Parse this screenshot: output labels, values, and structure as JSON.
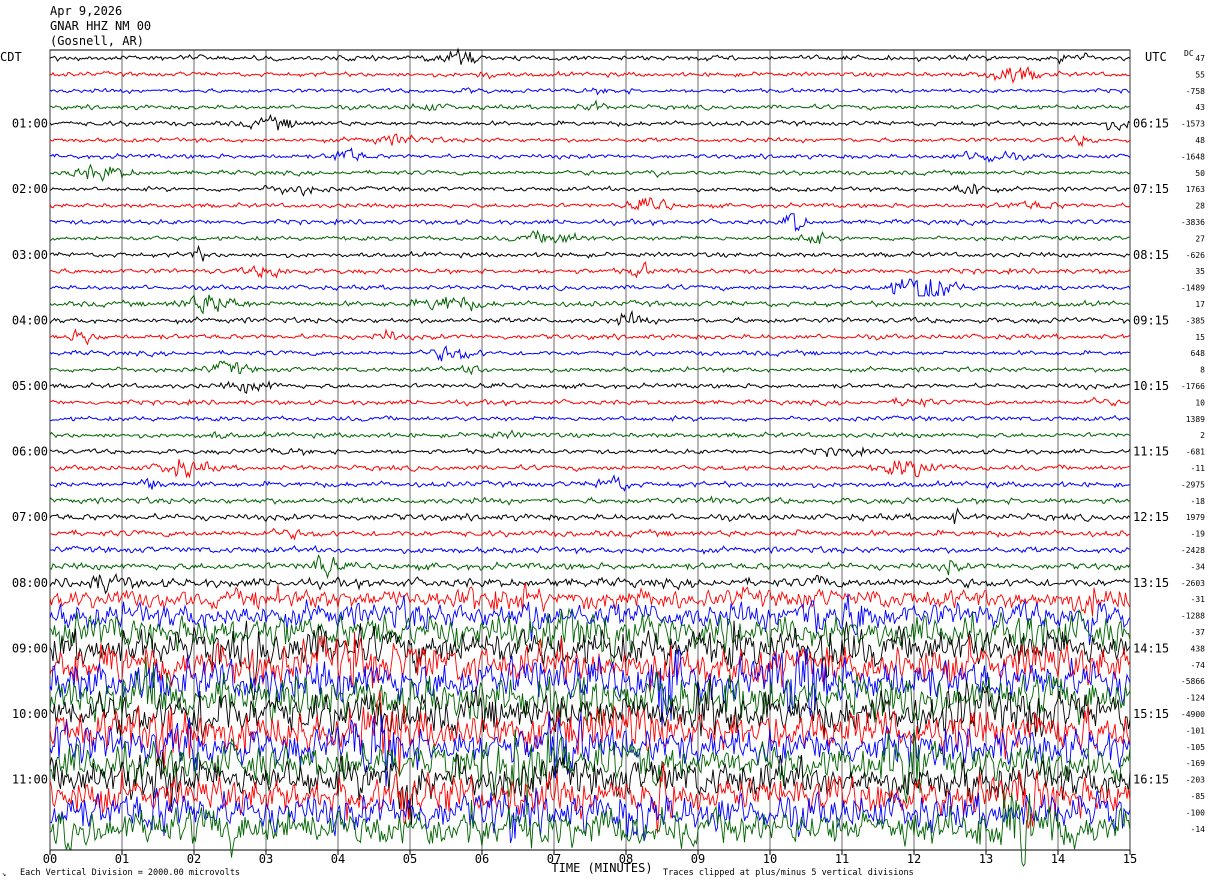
{
  "header": {
    "date": "Apr 9,2026",
    "station": "GNAR HHZ NM 00",
    "location": "(Gosnell, AR)"
  },
  "left_tz": "CDT",
  "right_tz": "UTC",
  "dc_label": "DC",
  "footer": {
    "scale_note": "Each Vertical Division = 2000.00 microvolts",
    "xlabel": "TIME (MINUTES)",
    "clip_note": "Traces clipped at plus/minus 5 vertical divisions"
  },
  "chart_data": {
    "type": "line",
    "title": "GNAR HHZ NM 00",
    "xlabel": "TIME (MINUTES)",
    "x_ticks": [
      "00",
      "01",
      "02",
      "03",
      "04",
      "05",
      "06",
      "07",
      "08",
      "09",
      "10",
      "11",
      "12",
      "13",
      "14",
      "15"
    ],
    "xlim": [
      0,
      15
    ],
    "trace_colors": [
      "#000000",
      "#ff0000",
      "#0000ff",
      "#006400"
    ],
    "left_time_labels": [
      "01:00",
      "02:00",
      "03:00",
      "04:00",
      "05:00",
      "06:00",
      "07:00",
      "08:00",
      "09:00",
      "10:00",
      "11:00"
    ],
    "right_time_labels": [
      "06:15",
      "07:15",
      "08:15",
      "09:15",
      "10:15",
      "11:15",
      "12:15",
      "13:15",
      "14:15",
      "15:15",
      "16:15"
    ],
    "dc_offsets": [
      "47",
      "55",
      "-758",
      "43",
      "-1573",
      "48",
      "-1648",
      "50",
      "1763",
      "28",
      "-3836",
      "27",
      "-626",
      "35",
      "-1489",
      "17",
      "-385",
      "15",
      "648",
      "8",
      "-1766",
      "10",
      "1389",
      "2",
      "-681",
      "-11",
      "-2975",
      "-18",
      "1979",
      "-19",
      "-2428",
      "-34",
      "-2603",
      "-31",
      "-1288",
      "-37",
      "438",
      "-74",
      "-5866",
      "-124",
      "-4900",
      "-101",
      "-105",
      "-169",
      "-203",
      "-85",
      "-100",
      "-14"
    ],
    "noise_levels": [
      1.5,
      1.3,
      1.2,
      1.3,
      1.4,
      1.3,
      1.3,
      1.3,
      1.3,
      1.3,
      1.4,
      1.3,
      1.4,
      1.5,
      1.4,
      1.6,
      1.6,
      1.5,
      1.4,
      1.4,
      1.4,
      1.4,
      1.4,
      1.4,
      1.4,
      1.5,
      1.6,
      1.8,
      1.9,
      1.8,
      1.8,
      2.0,
      2.6,
      5.5,
      7.5,
      9.5,
      11,
      12,
      12,
      12,
      12,
      12,
      11,
      11,
      11,
      11,
      11,
      11
    ]
  }
}
